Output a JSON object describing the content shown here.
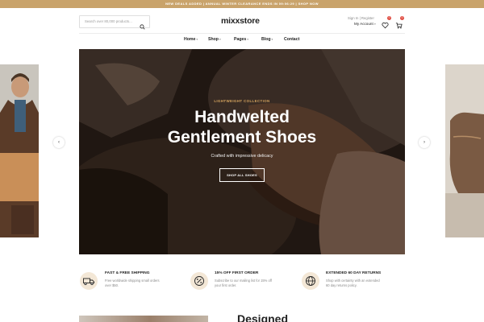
{
  "announcement": "NEW DEALS ADDED | ANNUAL WINTER CLEARANCE ENDS IN 09:06:29 | SHOP NOW",
  "header": {
    "search_placeholder": "Search over 80,000 products...",
    "logo": "mixxstore",
    "account_line1": "Sign In | Register",
    "account_line2": "My Account",
    "wishlist_count": "0",
    "cart_count": "0"
  },
  "nav": [
    {
      "label": "Home"
    },
    {
      "label": "Shop"
    },
    {
      "label": "Pages"
    },
    {
      "label": "Blog"
    },
    {
      "label": "Contact"
    }
  ],
  "hero": {
    "subtitle": "LIGHTWEIGHT COLLECTION",
    "title_line1": "Handwelted",
    "title_line2": "Gentlement Shoes",
    "text": "Crafted with impressive delicacy",
    "button": "SHOP ALL SHOES",
    "prev_icon": "chevron-left-icon",
    "next_icon": "chevron-right-icon"
  },
  "features": [
    {
      "icon": "truck-icon",
      "title": "FAST & FREE SHIPPING",
      "desc": "Free worldwide shipping small orders over $50."
    },
    {
      "icon": "percent-icon",
      "title": "15% OFF FIRST ORDER",
      "desc": "Subscribe to our mailing list for 15% off your first order."
    },
    {
      "icon": "globe-icon",
      "title": "EXTENDED 60 DAY RETURNS",
      "desc": "Shop with certainty with an extended 60 day returns policy."
    }
  ],
  "bottom": {
    "heading": "Designed"
  },
  "colors": {
    "accent": "#c9a36b",
    "badge": "#e04a3f",
    "feature_icon_bg": "#f3e7d6"
  }
}
